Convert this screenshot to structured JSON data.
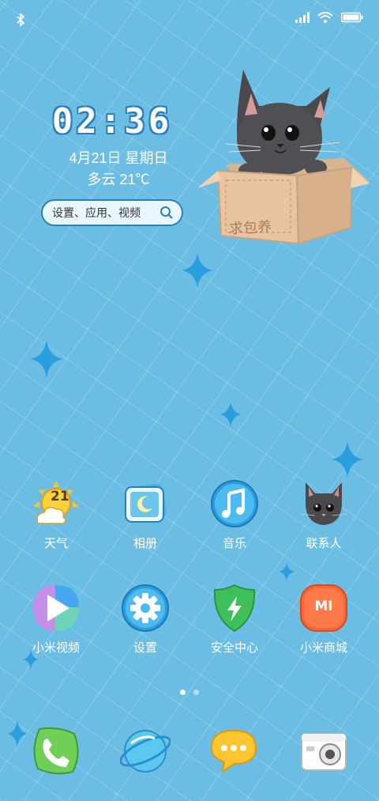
{
  "statusbar": {
    "icons": [
      "bluetooth-icon",
      "signal-icon",
      "wifi-icon",
      "battery-icon"
    ]
  },
  "widget": {
    "time": "02:36",
    "date": "4月21日 星期日",
    "weather": "多云 21℃",
    "search_value": "设置、应用、视频"
  },
  "sticker": {
    "box_text": "求包养"
  },
  "apps_row1": [
    {
      "label": "天气",
      "icon": "weather-icon",
      "badge": "21"
    },
    {
      "label": "相册",
      "icon": "gallery-icon"
    },
    {
      "label": "音乐",
      "icon": "music-icon"
    },
    {
      "label": "联系人",
      "icon": "contacts-cat-icon"
    }
  ],
  "apps_row2": [
    {
      "label": "小米视频",
      "icon": "video-icon"
    },
    {
      "label": "设置",
      "icon": "settings-gear-icon"
    },
    {
      "label": "安全中心",
      "icon": "security-shield-icon"
    },
    {
      "label": "小米商城",
      "icon": "mi-store-icon",
      "badge": "MI"
    }
  ],
  "dock": [
    {
      "icon": "phone-icon"
    },
    {
      "icon": "browser-icon"
    },
    {
      "icon": "messages-icon"
    },
    {
      "icon": "camera-icon"
    }
  ],
  "pager": {
    "pages": 2,
    "current": 1
  },
  "colors": {
    "background": "#6cbde4",
    "accent": "#2a7fb6"
  }
}
